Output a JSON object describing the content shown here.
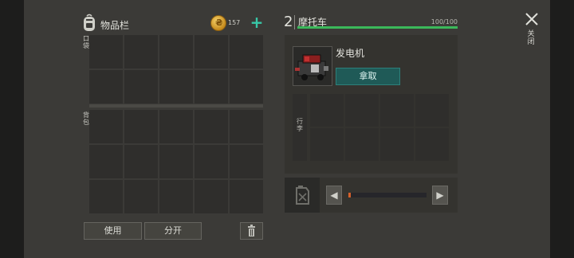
{
  "inventory": {
    "title": "物品栏",
    "coin_count": "157",
    "coin_glyph": "₴",
    "add_glyph": "+",
    "pocket_label": "口袋",
    "backpack_label": "背包",
    "pocket_slots": 10,
    "backpack_slots": 15,
    "use_label": "使用",
    "split_label": "分开"
  },
  "vehicle": {
    "number": "2",
    "title": "摩托车",
    "hp_text": "100/100",
    "hp_fraction": 1.0,
    "hp_color": "#3bb85a",
    "item_name": "发电机",
    "take_label": "拿取",
    "storage_label": "行李",
    "storage_slots": 8,
    "fuel_fraction": 0.03,
    "left_arrow": "◀",
    "right_arrow": "▶"
  },
  "close_label": "关闭",
  "icons": [
    "backpack-icon",
    "coin-icon",
    "add-icon",
    "engine-icon",
    "fuel-can-icon",
    "trash-icon",
    "close-icon"
  ]
}
